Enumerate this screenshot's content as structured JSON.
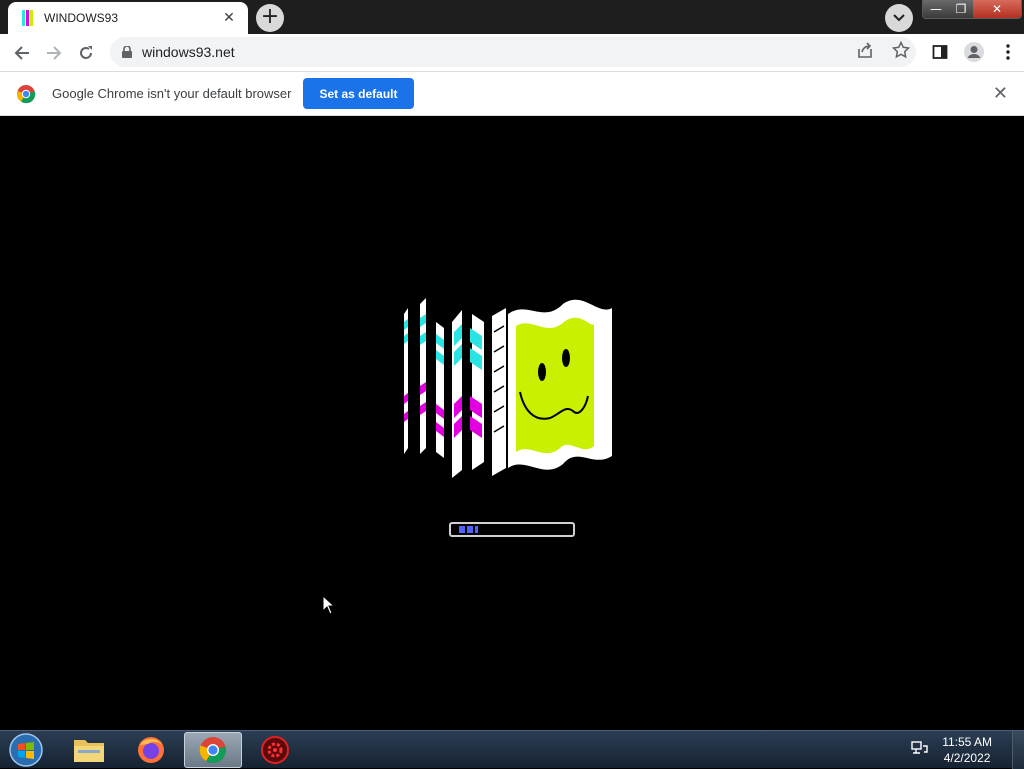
{
  "tab": {
    "title": "WINDOWS93",
    "close": "✕"
  },
  "newtab": "+",
  "window_controls": {
    "minimize": "—",
    "maximize": "❐",
    "close": "✕"
  },
  "toolbar": {
    "url": "windows93.net"
  },
  "infobar": {
    "message": "Google Chrome isn't your default browser",
    "button": "Set as default",
    "close": "✕"
  },
  "boot": {
    "progress": 0.18
  },
  "taskbar": {
    "apps": [
      "windows-explorer",
      "firefox",
      "chrome",
      "tool-app"
    ],
    "active": "chrome"
  },
  "clock": {
    "time": "11:55 AM",
    "date": "4/2/2022"
  },
  "colors": {
    "cyan": "#2ae3e3",
    "magenta": "#e000e0",
    "lime": "#c8f000",
    "accent": "#1a73e8"
  }
}
